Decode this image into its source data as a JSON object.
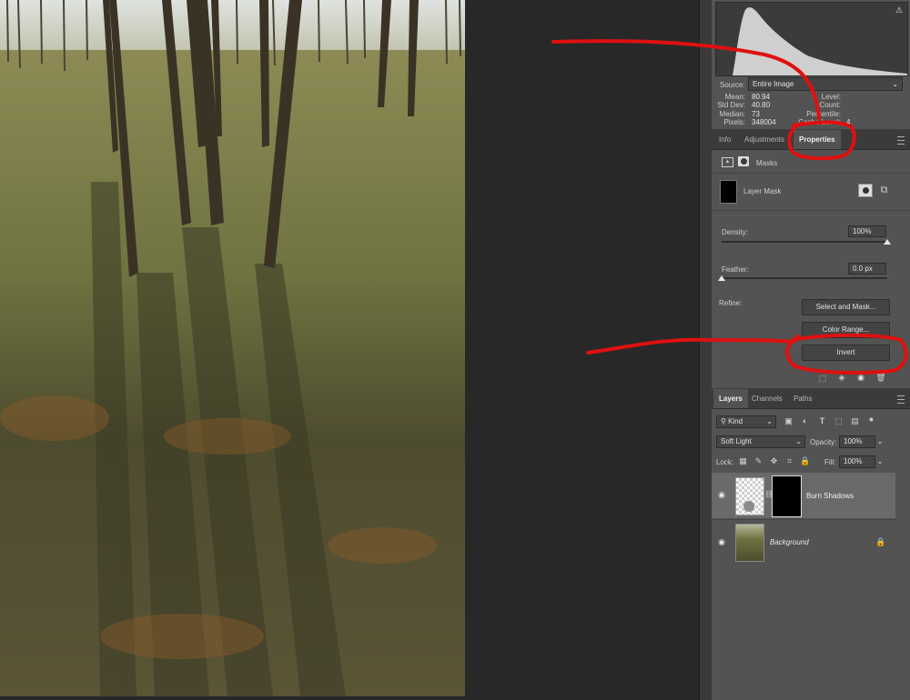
{
  "histogram": {
    "source_label": "Source:",
    "source_value": "Entire Image",
    "stats_left": [
      {
        "label": "Mean:",
        "value": "80.94"
      },
      {
        "label": "Std Dev:",
        "value": "40.80"
      },
      {
        "label": "Median:",
        "value": "73"
      },
      {
        "label": "Pixels:",
        "value": "348004"
      }
    ],
    "stats_right": [
      {
        "label": "Level:",
        "value": ""
      },
      {
        "label": "Count:",
        "value": ""
      },
      {
        "label": "Percentile:",
        "value": ""
      },
      {
        "label": "Cache Level:",
        "value": "4"
      }
    ],
    "warning_icon": "warning-icon"
  },
  "properties_panel": {
    "tabs": [
      "Info",
      "Adjustments",
      "Properties"
    ],
    "active_tab": "Properties",
    "masks_label": "Masks",
    "layer_mask_label": "Layer Mask",
    "density_label": "Density:",
    "density_value": "100%",
    "density_level": 1.0,
    "feather_label": "Feather:",
    "feather_value": "0.0 px",
    "feather_level": 0.0,
    "refine_label": "Refine:",
    "buttons": [
      "Select and Mask...",
      "Color Range...",
      "Invert"
    ]
  },
  "layers_panel": {
    "tabs": [
      "Layers",
      "Channels",
      "Paths"
    ],
    "active_tab": "Layers",
    "filter_kind": "Kind",
    "blend_mode": "Soft Light",
    "opacity_label": "Opacity:",
    "opacity_value": "100%",
    "lock_label": "Lock:",
    "fill_label": "Fill:",
    "fill_value": "100%",
    "layers": [
      {
        "name": "Burn Shadows",
        "visible": true,
        "selected": true,
        "has_mask": true
      },
      {
        "name": "Background",
        "visible": true,
        "locked": true
      }
    ]
  },
  "colors": {
    "annotation_red": "#e01010",
    "panel_bg": "#535353",
    "selected_layer": "#6a6a6a"
  }
}
